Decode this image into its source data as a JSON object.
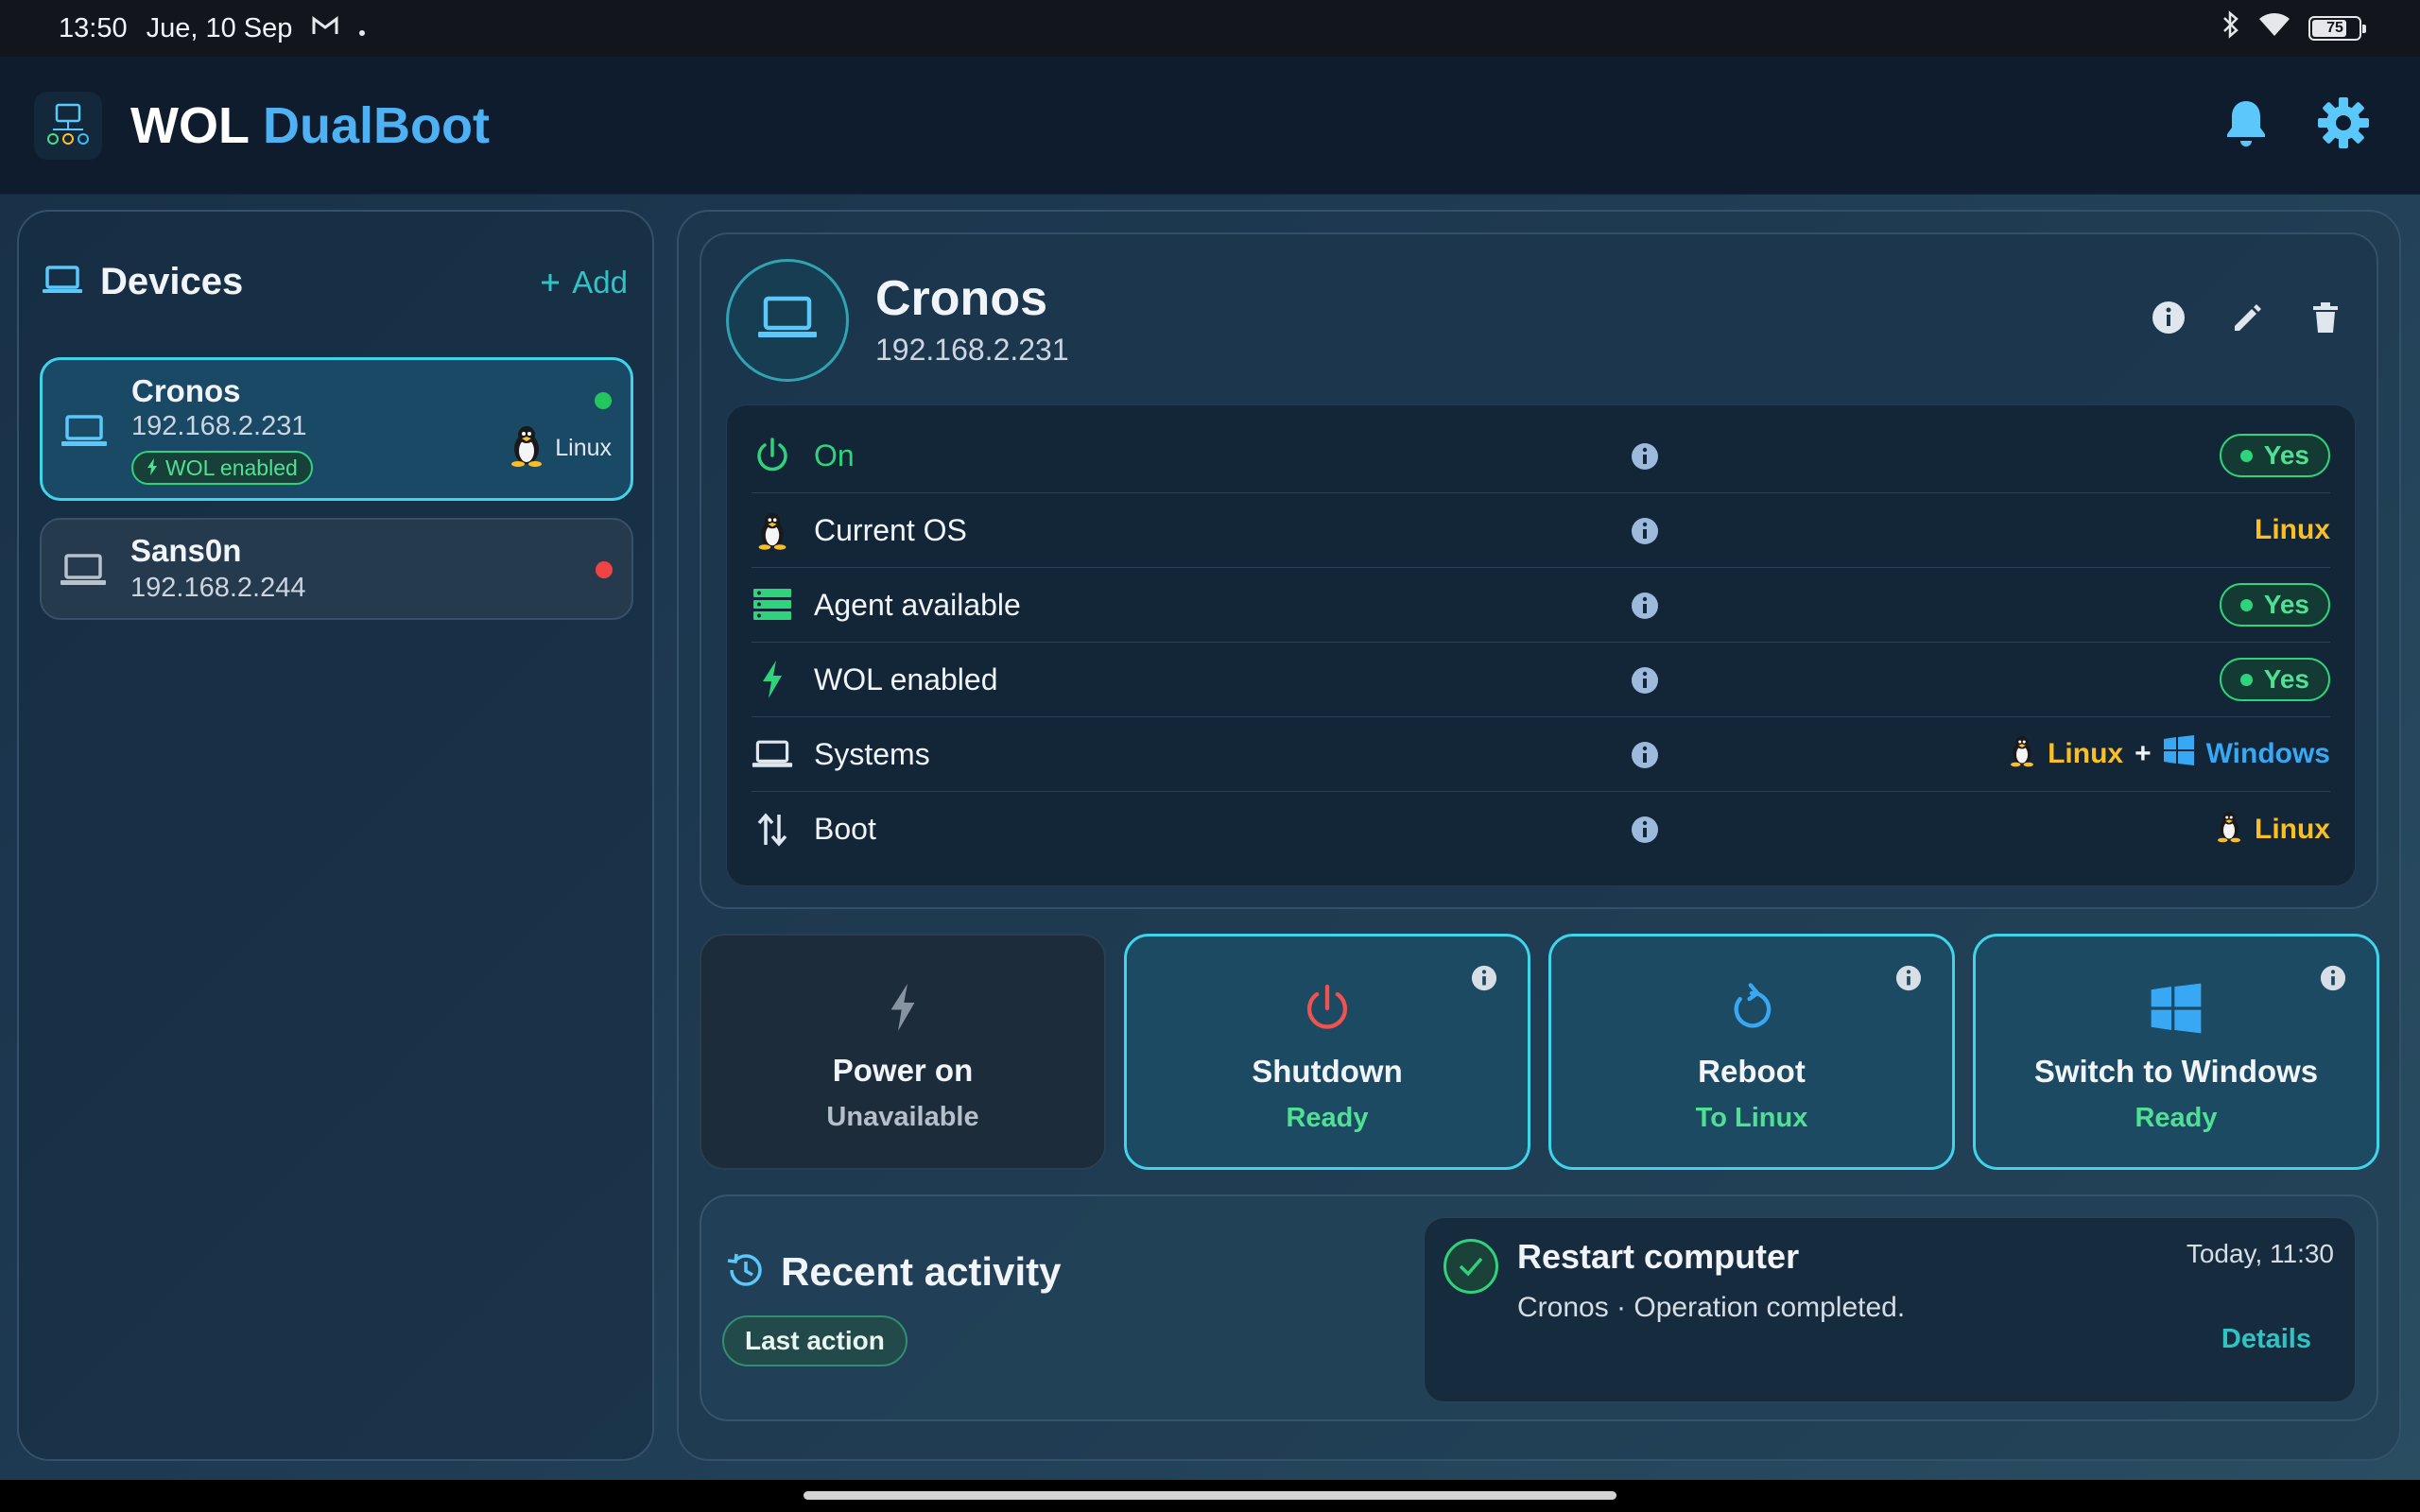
{
  "status_bar": {
    "time": "13:50",
    "date": "Jue, 10 Sep",
    "battery": "75"
  },
  "app": {
    "title_part1": "WOL",
    "title_part2": "DualBoot"
  },
  "devices_panel": {
    "title": "Devices",
    "add_label": "Add",
    "devices": [
      {
        "name": "Cronos",
        "ip": "192.168.2.231",
        "badge": "WOL enabled",
        "os": "Linux",
        "status": "online",
        "status_color": "#22c55e"
      },
      {
        "name": "Sans0n",
        "ip": "192.168.2.244",
        "status": "offline",
        "status_color": "#ef4444"
      }
    ]
  },
  "selected_device": {
    "name": "Cronos",
    "ip": "192.168.2.231",
    "rows": [
      {
        "label": "On",
        "value": "Yes"
      },
      {
        "label": "Current OS",
        "value": "Linux"
      },
      {
        "label": "Agent available",
        "value": "Yes"
      },
      {
        "label": "WOL enabled",
        "value": "Yes"
      },
      {
        "label": "Systems",
        "value_linux": "Linux",
        "value_plus": "+",
        "value_windows": "Windows"
      },
      {
        "label": "Boot",
        "value": "Linux"
      }
    ]
  },
  "actions": [
    {
      "title": "Power on",
      "subtitle": "Unavailable",
      "enabled": false
    },
    {
      "title": "Shutdown",
      "subtitle": "Ready",
      "enabled": true
    },
    {
      "title": "Reboot",
      "subtitle": "To Linux",
      "enabled": true
    },
    {
      "title": "Switch to Windows",
      "subtitle": "Ready",
      "enabled": true
    }
  ],
  "recent_activity": {
    "title": "Recent activity",
    "chip": "Last action",
    "item": {
      "title": "Restart computer",
      "description": "Cronos · Operation completed.",
      "time": "Today, 11:30",
      "details_label": "Details"
    }
  },
  "colors": {
    "accent": "#3fd4ea",
    "green": "#2ed37c",
    "linux_yellow": "#fbbf24",
    "windows_blue": "#38a8f5",
    "danger": "#ef5350"
  }
}
